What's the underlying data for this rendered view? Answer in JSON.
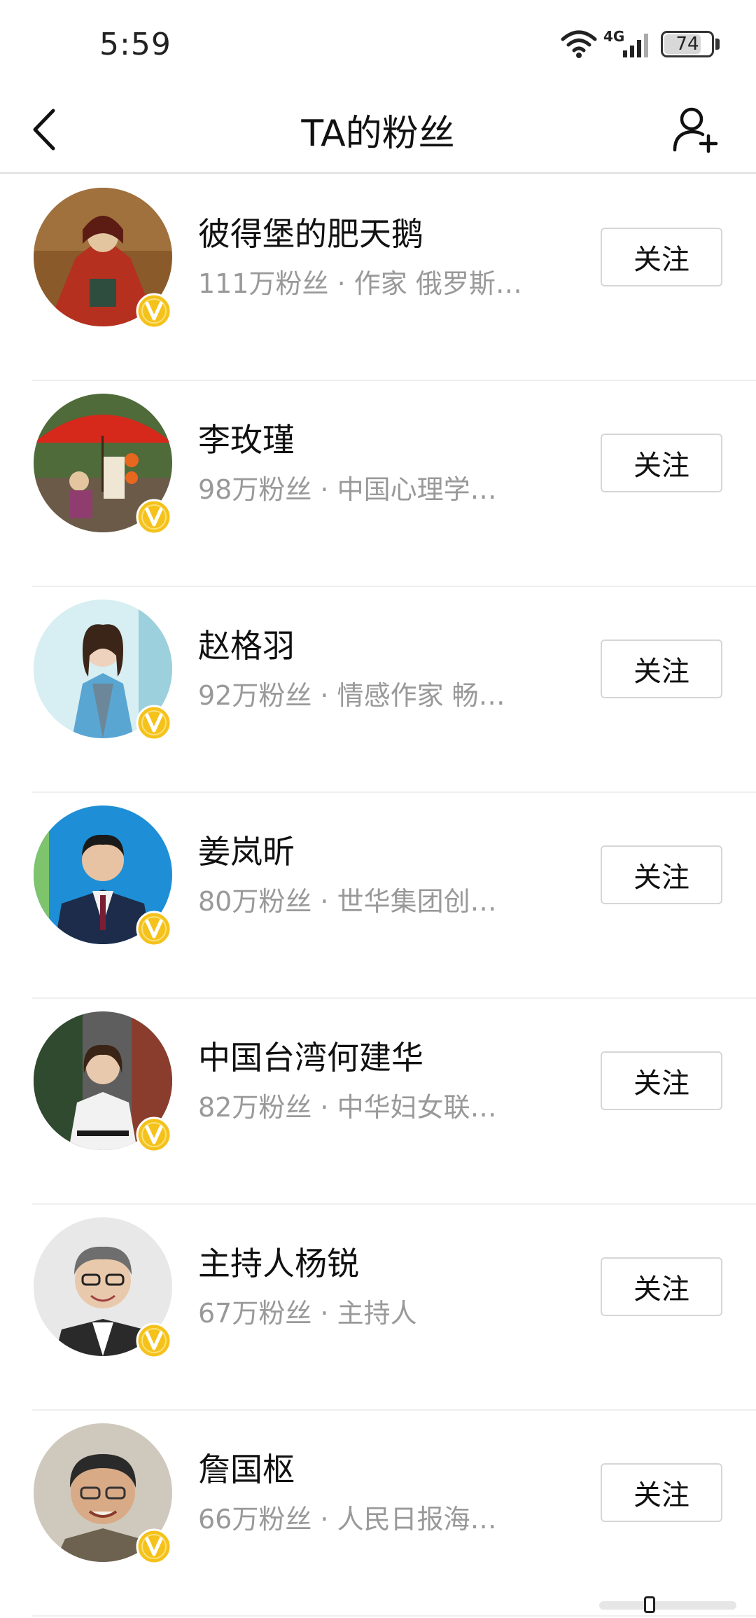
{
  "status_bar": {
    "time": "5:59",
    "network": "4G",
    "battery": "74",
    "battery_level": 0.74
  },
  "header": {
    "title": "TA的粉丝",
    "back_icon": "chevron-left-icon",
    "right_icon": "add-user-icon"
  },
  "fans": [
    {
      "name": "彼得堡的肥天鹅",
      "meta": "111万粉丝 · 作家 俄罗斯…",
      "follow_label": "关注",
      "avatar": "painting"
    },
    {
      "name": "李玫瑾",
      "meta": "98万粉丝 · 中国心理学…",
      "follow_label": "关注",
      "avatar": "umbrella"
    },
    {
      "name": "赵格羽",
      "meta": "92万粉丝 · 情感作家 畅…",
      "follow_label": "关注",
      "avatar": "woman-blue"
    },
    {
      "name": "姜岚昕",
      "meta": "80万粉丝 · 世华集团创…",
      "follow_label": "关注",
      "avatar": "man-suit"
    },
    {
      "name": "中国台湾何建华",
      "meta": "82万粉丝 · 中华妇女联…",
      "follow_label": "关注",
      "avatar": "woman-street"
    },
    {
      "name": "主持人杨锐",
      "meta": "67万粉丝 · 主持人",
      "follow_label": "关注",
      "avatar": "man-glasses"
    },
    {
      "name": "詹国枢",
      "meta": "66万粉丝 · 人民日报海…",
      "follow_label": "关注",
      "avatar": "old-man"
    }
  ],
  "colors": {
    "verified_badge": "#f5c21b",
    "secondary_text": "#999999",
    "divider": "#efefef"
  }
}
